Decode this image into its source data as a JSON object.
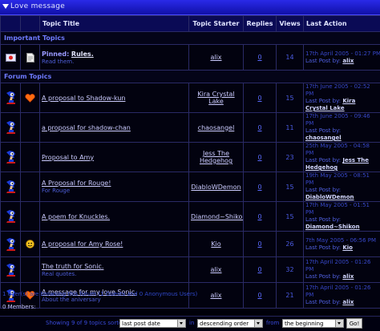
{
  "header": {
    "title": "Love message"
  },
  "columns": {
    "topic_title": "Topic Title",
    "topic_starter": "Topic Starter",
    "replies": "Replies",
    "views": "Views",
    "last_action": "Last Action"
  },
  "sections": {
    "important": "Important Topics",
    "forum": "Forum Topics"
  },
  "pinned": {
    "prefix": "Pinned:",
    "title": "Rules.",
    "desc": "Read them.",
    "starter": "alix",
    "replies": "0",
    "views": "14",
    "last_date": "17th April 2005 - 01:27 PM",
    "last_by_label": "Last Post by:",
    "last_by": "alix"
  },
  "topics": [
    {
      "title": "A proposal to Shadow-kun",
      "desc": "",
      "starter": "Kira Crystal Lake",
      "replies": "0",
      "views": "15",
      "last_date": "17th June 2005 - 02:52 PM",
      "last_by_label": "Last Post by:",
      "last_by": "Kira Crystal Lake",
      "icon": "heart"
    },
    {
      "title": "a proposal for shadow-chan",
      "desc": "",
      "starter": "chaosangel",
      "replies": "0",
      "views": "11",
      "last_date": "17th June 2005 - 09:46 PM",
      "last_by_label": "Last Post by:",
      "last_by": "chaosangel",
      "icon": "none"
    },
    {
      "title": "Proposal to Amy",
      "desc": "",
      "starter": "Jess The Hedgehog",
      "replies": "0",
      "views": "23",
      "last_date": "25th May 2005 - 04:58 PM",
      "last_by_label": "Last Post by:",
      "last_by": "Jess The Hedgehog",
      "icon": "none"
    },
    {
      "title": "A Proposal for Rouge!",
      "desc": "For Rouge",
      "starter": "DiabloWDemon",
      "replies": "0",
      "views": "15",
      "last_date": "19th May 2005 - 08:51 PM",
      "last_by_label": "Last Post by:",
      "last_by": "DiabloWDemon",
      "icon": "none"
    },
    {
      "title": "A poem for Knuckles.",
      "desc": "",
      "starter": "Diamond~Shikon",
      "replies": "0",
      "views": "15",
      "last_date": "17th May 2005 - 01:51 PM",
      "last_by_label": "Last Post by:",
      "last_by": "Diamond~Shikon",
      "icon": "none"
    },
    {
      "title": "A proposal for Amy Rose!",
      "desc": "",
      "starter": "Kio",
      "replies": "0",
      "views": "26",
      "last_date": "7th May 2005 - 06:56 PM",
      "last_by_label": "Last Post by:",
      "last_by": "Kio",
      "icon": "sun"
    },
    {
      "title": "The truth for Sonic.",
      "desc": "Real quotes.",
      "starter": "alix",
      "replies": "0",
      "views": "32",
      "last_date": "17th April 2005 - 01:26 PM",
      "last_by_label": "Last Post by:",
      "last_by": "alix",
      "icon": "none"
    },
    {
      "title": "A message for my love Sonic.",
      "desc": "About the aniversary",
      "starter": "alix",
      "replies": "0",
      "views": "21",
      "last_date": "17th April 2005 - 01:26 PM",
      "last_by_label": "Last Post by:",
      "last_by": "alix",
      "icon": "heart"
    }
  ],
  "footer": {
    "browsing": "1 User(s) are browsing this forum (1 Guests and 0 Anonymous Users)",
    "members": "0 Members:"
  },
  "sort": {
    "showing_text": "Showing 9 of 9 topics sorted by",
    "sort_by": "last post date",
    "in_text": "in",
    "order": "descending order",
    "from_text": "from",
    "range": "the beginning",
    "go": "Go!"
  },
  "colors": {
    "accent": "#1a1ad0",
    "link": "#8fa8ff",
    "background": "#00000a"
  }
}
